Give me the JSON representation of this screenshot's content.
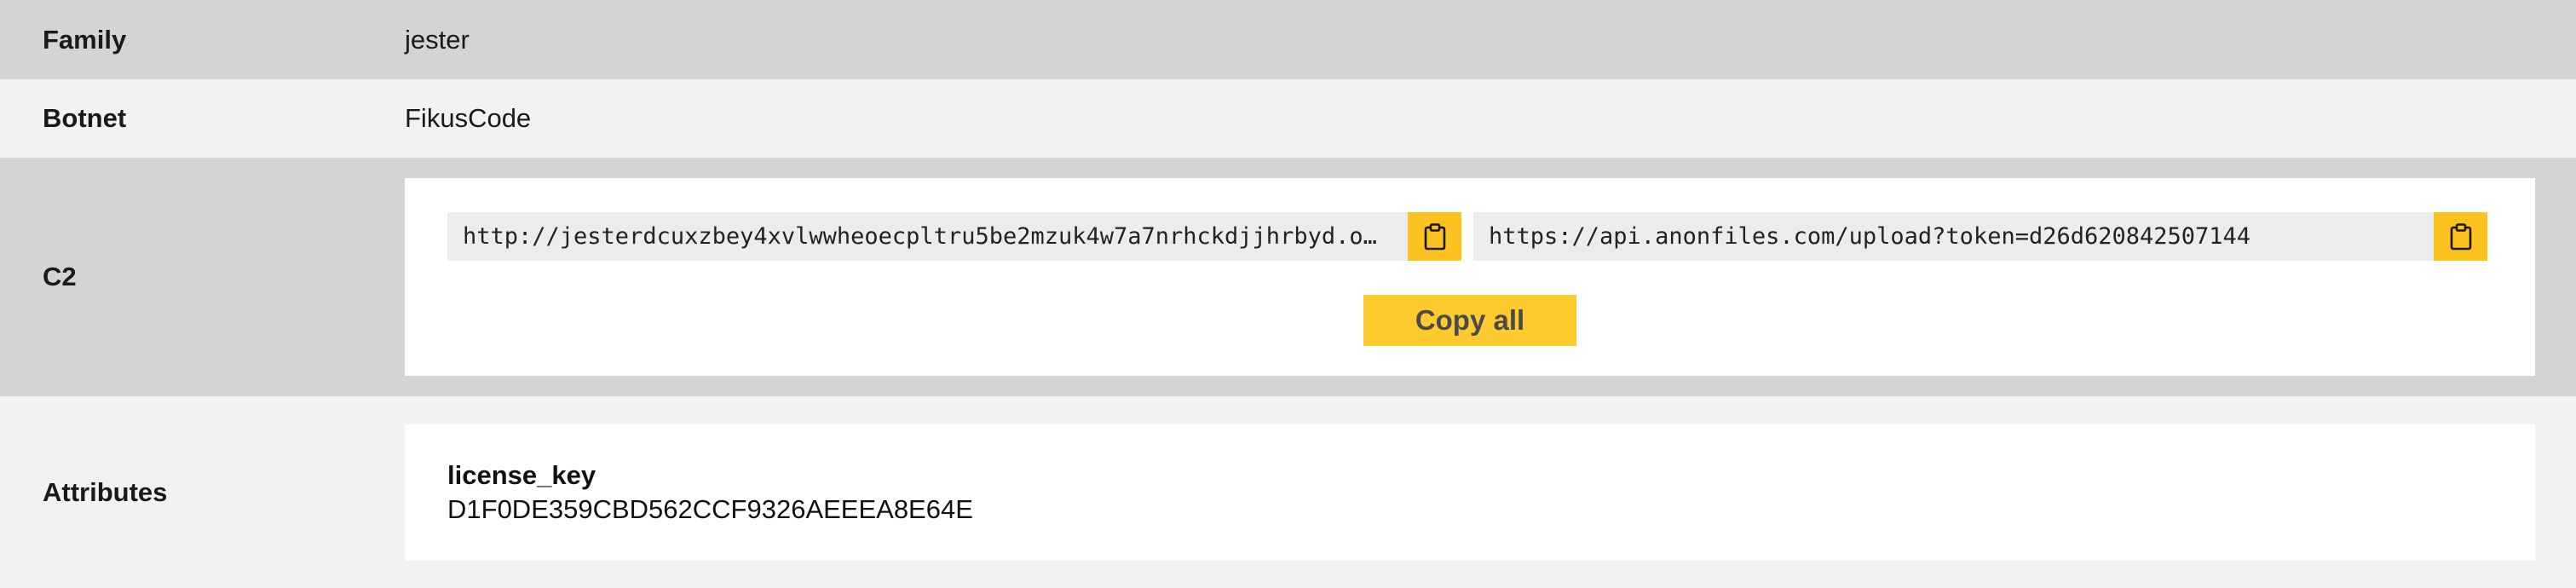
{
  "rows": {
    "family": {
      "label": "Family",
      "value": "jester"
    },
    "botnet": {
      "label": "Botnet",
      "value": "FikusCode"
    },
    "c2": {
      "label": "C2",
      "urls": [
        "http://jesterdcuxzbey4xvlwwheoecpltru5be2mzuk4w7a7nrhckdjjhrbyd.o…",
        "https://api.anonfiles.com/upload?token=d26d620842507144"
      ],
      "copy_all_label": "Copy all",
      "clipboard_icon": "clipboard-icon"
    },
    "attributes": {
      "label": "Attributes",
      "key": "license_key",
      "value": "D1F0DE359CBD562CCF9326AEEEA8E64E"
    }
  },
  "colors": {
    "row_dark": "#d4d4d6",
    "row_light": "#f2f2f2",
    "accent": "#fcc21f",
    "url_bg": "#ebecee"
  }
}
